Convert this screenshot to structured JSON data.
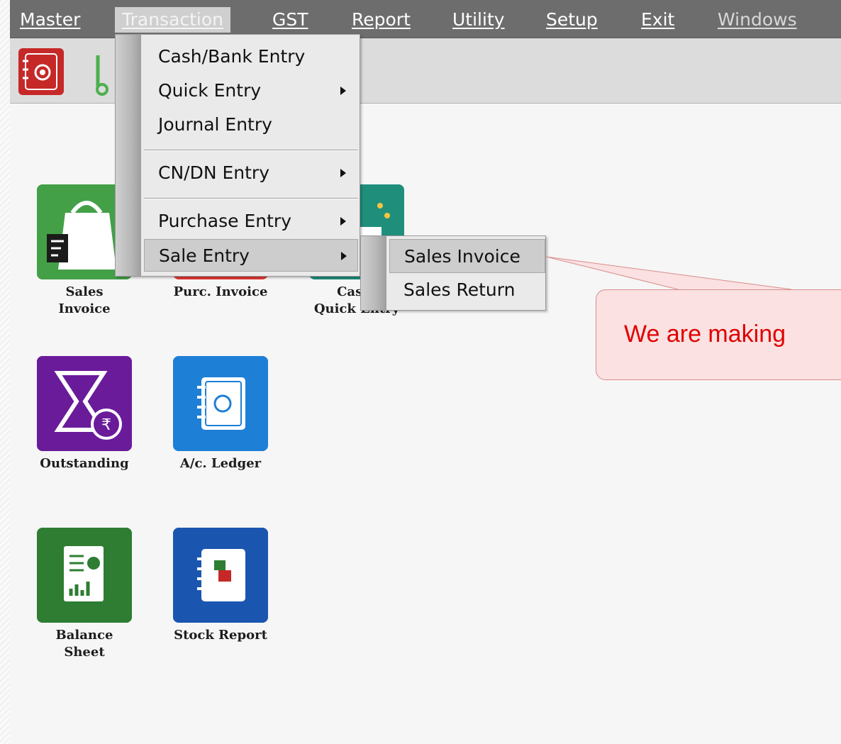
{
  "menubar": {
    "items": [
      "Master",
      "Transaction",
      "GST",
      "Report",
      "Utility",
      "Setup",
      "Exit",
      "Windows"
    ]
  },
  "transaction_menu": {
    "items": [
      {
        "label": "Cash/Bank Entry"
      },
      {
        "label": "Quick Entry",
        "submenu": true
      },
      {
        "label": "Journal Entry"
      },
      {
        "label": "CN/DN Entry",
        "submenu": true
      },
      {
        "label": "Purchase Entry",
        "submenu": true
      },
      {
        "label": "Sale Entry",
        "submenu": true,
        "highlighted": true
      }
    ]
  },
  "sale_entry_submenu": {
    "items": [
      {
        "label": "Sales Invoice",
        "highlighted": true
      },
      {
        "label": "Sales Return"
      }
    ]
  },
  "desktop": {
    "tiles": [
      {
        "label": "Sales\nInvoice",
        "icon": "shopping-bag-icon",
        "color": "#4caf50"
      },
      {
        "label": "Purc. Invoice",
        "icon": "purchase-invoice-icon",
        "color": "#e53935"
      },
      {
        "label": "Cash/\nQuick Entry",
        "icon": "cash-quick-entry-icon",
        "color": "#26a69a"
      },
      {
        "label": "Outstanding",
        "icon": "hourglass-rupee-icon",
        "color": "#7b1fa2"
      },
      {
        "label": "A/c. Ledger",
        "icon": "ledger-book-icon",
        "color": "#1e88e5"
      },
      {
        "label": "Balance\nSheet",
        "icon": "balance-sheet-icon",
        "color": "#2e7d32"
      },
      {
        "label": "Stock Report",
        "icon": "stock-report-icon",
        "color": "#1565c0"
      }
    ]
  },
  "callout": {
    "text": "We are making"
  },
  "colors": {
    "menubar_bg": "#6d6d6d",
    "callout_text": "#e00000",
    "callout_bg": "#fbe1e1"
  }
}
